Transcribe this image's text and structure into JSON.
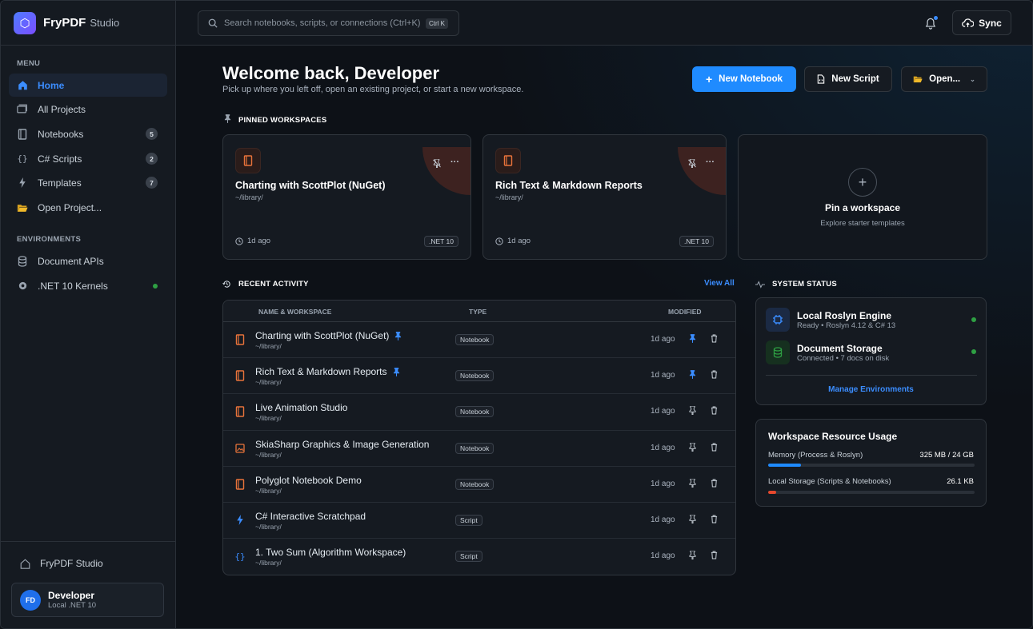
{
  "brand": {
    "name": "FryPDF",
    "sub": "Studio",
    "logo_icon": "hexagon-icon"
  },
  "sidebar": {
    "menu_heading": "MENU",
    "items": [
      {
        "label": "Home",
        "icon": "home-icon",
        "active": true
      },
      {
        "label": "All Projects",
        "icon": "folders-icon"
      },
      {
        "label": "Notebooks",
        "icon": "notebook-icon",
        "badge": "5"
      },
      {
        "label": "C# Scripts",
        "icon": "braces-icon",
        "badge": "2"
      },
      {
        "label": "Templates",
        "icon": "bolt-icon",
        "badge": "7"
      },
      {
        "label": "Open Project...",
        "icon": "folder-open-icon"
      }
    ],
    "env_heading": "ENVIRONMENTS",
    "envs": [
      {
        "label": "Document APIs",
        "icon": "database-icon"
      },
      {
        "label": ".NET 10 Kernels",
        "icon": "cpu-icon",
        "status": "online"
      }
    ],
    "footer_home": "FryPDF Studio",
    "user": {
      "initials": "FD",
      "name": "Developer",
      "sub": "Local .NET 10"
    }
  },
  "topbar": {
    "search_placeholder": "Search notebooks, scripts, or connections (Ctrl+K)",
    "search_kbd": "Ctrl K",
    "sync_label": "Sync"
  },
  "header": {
    "title": "Welcome back, Developer",
    "subtitle": "Pick up where you left off, open an existing project, or start a new workspace.",
    "new_notebook": "New Notebook",
    "new_script": "New Script",
    "open": "Open..."
  },
  "pinned": {
    "heading": "PINNED WORKSPACES",
    "cards": [
      {
        "title": "Charting with ScottPlot (NuGet)",
        "path": "~/library/",
        "time": "1d ago",
        "chip": ".NET 10"
      },
      {
        "title": "Rich Text & Markdown Reports",
        "path": "~/library/",
        "time": "1d ago",
        "chip": ".NET 10"
      }
    ],
    "pin_title": "Pin a workspace",
    "pin_sub": "Explore starter templates"
  },
  "recent": {
    "heading": "RECENT ACTIVITY",
    "view_all": "View All",
    "columns": {
      "name": "NAME & WORKSPACE",
      "type": "TYPE",
      "modified": "MODIFIED"
    },
    "rows": [
      {
        "name": "Charting with ScottPlot (NuGet)",
        "path": "~/library/",
        "type": "Notebook",
        "time": "1d ago",
        "pinned": true,
        "icon": "notebook-icon"
      },
      {
        "name": "Rich Text & Markdown Reports",
        "path": "~/library/",
        "type": "Notebook",
        "time": "1d ago",
        "pinned": true,
        "icon": "notebook-icon"
      },
      {
        "name": "Live Animation Studio",
        "path": "~/library/",
        "type": "Notebook",
        "time": "1d ago",
        "pinned": false,
        "icon": "notebook-icon"
      },
      {
        "name": "SkiaSharp Graphics & Image Generation",
        "path": "~/library/",
        "type": "Notebook",
        "time": "1d ago",
        "pinned": false,
        "icon": "image-icon"
      },
      {
        "name": "Polyglot Notebook Demo",
        "path": "~/library/",
        "type": "Notebook",
        "time": "1d ago",
        "pinned": false,
        "icon": "notebook-icon"
      },
      {
        "name": "C# Interactive Scratchpad",
        "path": "~/library/",
        "type": "Script",
        "time": "1d ago",
        "pinned": false,
        "icon": "bolt-icon"
      },
      {
        "name": "1. Two Sum (Algorithm Workspace)",
        "path": "~/library/",
        "type": "Script",
        "time": "1d ago",
        "pinned": false,
        "icon": "braces-icon"
      }
    ]
  },
  "system_status": {
    "heading": "SYSTEM STATUS",
    "envs": [
      {
        "title": "Local Roslyn Engine",
        "sub": "Ready • Roslyn 4.12 & C# 13",
        "icon": "chip-icon"
      },
      {
        "title": "Document Storage",
        "sub": "Connected • 7 docs on disk",
        "icon": "database-icon"
      }
    ],
    "manage": "Manage Environments"
  },
  "resources": {
    "title": "Workspace Resource Usage",
    "memory": {
      "label": "Memory (Process & Roslyn)",
      "value": "325 MB / 24 GB",
      "fraction": 0.16,
      "color": "#1f8bff"
    },
    "storage": {
      "label": "Local Storage (Scripts & Notebooks)",
      "value": "26.1 KB",
      "fraction": 0.04,
      "color": "#e5482d"
    }
  },
  "colors": {
    "accent": "#1f8bff",
    "notebook": "#e8733a",
    "script": "#3b8dff",
    "online": "#2ea043"
  }
}
